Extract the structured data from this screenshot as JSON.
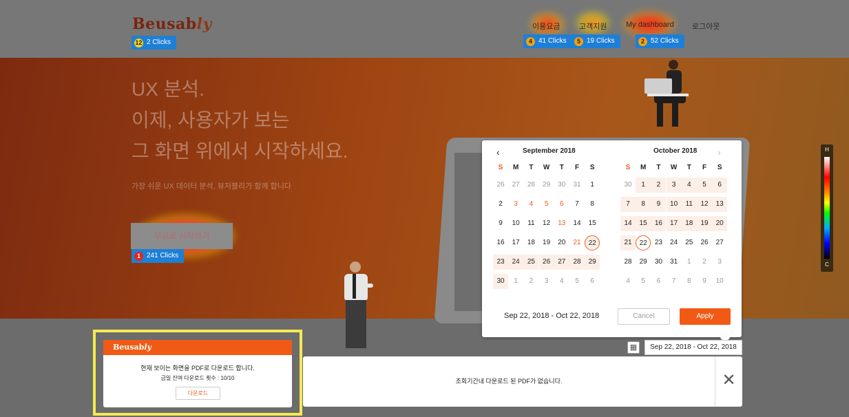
{
  "header": {
    "logo_main": "Beusab",
    "logo_tail": "ly",
    "logo_clicks": {
      "rank": "12",
      "label": "2 Clicks"
    },
    "nav": [
      {
        "label": "이용요금",
        "rank": "4",
        "clicks": "41 Clicks"
      },
      {
        "label": "고객지원",
        "rank": "5",
        "clicks": "19 Clicks"
      },
      {
        "label": "My dashboard",
        "rank": "2",
        "clicks": "52 Clicks"
      },
      {
        "label": "로그아웃"
      }
    ]
  },
  "hero": {
    "line1": "UX 분석.",
    "line2": "이제, 사용자가 보는",
    "line3": "그 화면 위에서 시작하세요.",
    "subtitle": "가장 쉬운 UX 데이터 분석, 뷰저블리가 함께 합니다",
    "cta_label": "무료로 시작하기",
    "cta_clicks": {
      "rank": "1",
      "label": "241 Clicks"
    }
  },
  "calendar": {
    "prev_icon": "‹",
    "next_icon": "›",
    "left_month": "September 2018",
    "right_month": "October 2018",
    "weekdays": [
      "S",
      "M",
      "T",
      "W",
      "T",
      "F",
      "S"
    ],
    "left_weeks": [
      [
        "26",
        "27",
        "28",
        "29",
        "30",
        "31",
        "1"
      ],
      [
        "2",
        "3",
        "4",
        "5",
        "6",
        "7",
        "8"
      ],
      [
        "9",
        "10",
        "11",
        "12",
        "13",
        "14",
        "15"
      ],
      [
        "16",
        "17",
        "18",
        "19",
        "20",
        "21",
        "22"
      ],
      [
        "23",
        "24",
        "25",
        "26",
        "27",
        "28",
        "29"
      ],
      [
        "30",
        "1",
        "2",
        "3",
        "4",
        "5",
        "6"
      ]
    ],
    "right_weeks": [
      [
        "30",
        "1",
        "2",
        "3",
        "4",
        "5",
        "6"
      ],
      [
        "7",
        "8",
        "9",
        "10",
        "11",
        "12",
        "13"
      ],
      [
        "14",
        "15",
        "16",
        "17",
        "18",
        "19",
        "20"
      ],
      [
        "21",
        "22",
        "23",
        "24",
        "25",
        "26",
        "27"
      ],
      [
        "28",
        "29",
        "30",
        "31",
        "1",
        "2",
        "3"
      ],
      [
        "4",
        "5",
        "6",
        "7",
        "8",
        "9",
        "10"
      ]
    ],
    "range_text": "Sep 22, 2018 - Oct 22, 2018",
    "cancel_label": "Cancel",
    "apply_label": "Apply",
    "accent_color": "#f15a14"
  },
  "heat_scale": {
    "high": "H",
    "low": "C"
  },
  "date_filter": {
    "icon": "calendar-icon",
    "value": "Sep 22, 2018 - Oct 22, 2018"
  },
  "pdf_panel": {
    "brand_main": "Beusab",
    "brand_tail": "ly",
    "title": "현재 보이는 화면을 PDF로 다운로드 합니다.",
    "remaining": "금일 잔여 다운로드 횟수 : 10/10",
    "download_label": "다운로드"
  },
  "message_bar": {
    "text": "조회기간내 다운로드 된 PDF가 없습니다.",
    "close_icon": "✕"
  }
}
